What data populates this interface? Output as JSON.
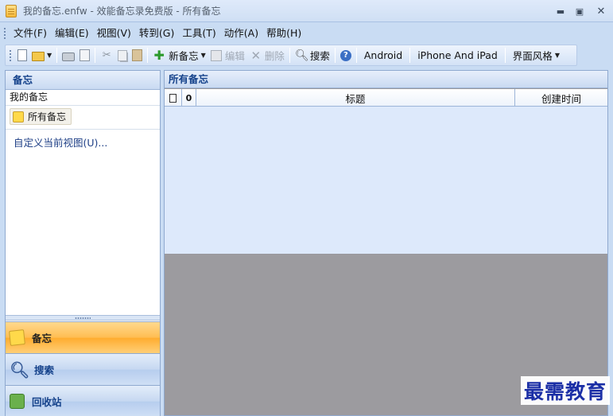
{
  "window": {
    "title": "我的备忘.enfw - 效能备忘录免费版 - 所有备忘",
    "controls": {
      "minimize": "▬",
      "maximize": "▣",
      "close": "✕"
    }
  },
  "menu": [
    "文件(F)",
    "编辑(E)",
    "视图(V)",
    "转到(G)",
    "工具(T)",
    "动作(A)",
    "帮助(H)"
  ],
  "toolbar": {
    "new_memo": "新备忘",
    "edit": "编辑",
    "delete": "删除",
    "search": "搜索",
    "android": "Android",
    "iphone": "iPhone And iPad",
    "style": "界面风格"
  },
  "left_pane": {
    "header": "备忘",
    "tree_root": "我的备忘",
    "folder": "所有备忘",
    "customize_link": "自定义当前视图(U)...",
    "nav": [
      {
        "label": "备忘",
        "icon": "notes-icon",
        "active": true
      },
      {
        "label": "搜索",
        "icon": "search-icon",
        "active": false
      },
      {
        "label": "回收站",
        "icon": "recycle-bin-icon",
        "active": false
      }
    ]
  },
  "right_pane": {
    "header": "所有备忘",
    "columns": {
      "title": "标题",
      "created": "创建时间"
    }
  },
  "watermark": "最需教育",
  "colors": {
    "accent": "#15428b",
    "active_nav": "#ffbd52",
    "watermark": "#1b2fa6"
  }
}
